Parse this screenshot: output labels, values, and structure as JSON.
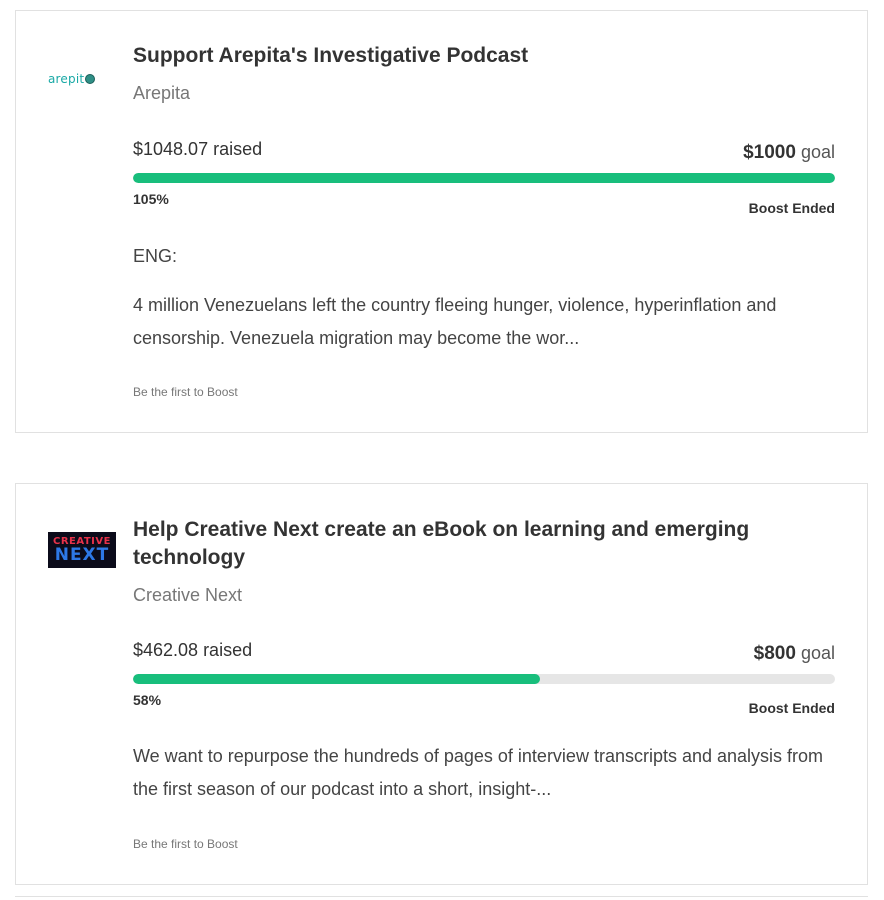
{
  "campaigns": [
    {
      "logo": {
        "type": "wordmark",
        "icon_name": "arepita-logo",
        "text": "arepit",
        "colors": {
          "text": "#19a9a6",
          "dot": "#2f8f86"
        }
      },
      "title": "Support Arepita's Investigative Podcast",
      "organization": "Arepita",
      "raised": "$1048.07 raised",
      "goal_amount": "$1000",
      "goal_suffix": "goal",
      "percent_label": "105%",
      "progress_fraction": 1.0,
      "status": "Boost Ended",
      "description_lead": "ENG:",
      "description": "4 million Venezuelans left the country fleeing hunger, violence, hyperinflation and censorship. Venezuela migration may become the wor...",
      "boost_cta": "Be the first to Boost"
    },
    {
      "logo": {
        "type": "image",
        "icon_name": "creative-next-logo",
        "line1": "CREATIVE",
        "line2": "NEXT",
        "colors": {
          "bg": "#0b0b1a",
          "line1": "#e8324a",
          "line2": "#2d78e6"
        }
      },
      "title": "Help Creative Next create an eBook on learning and emerging technology",
      "organization": "Creative Next",
      "raised": "$462.08 raised",
      "goal_amount": "$800",
      "goal_suffix": "goal",
      "percent_label": "58%",
      "progress_fraction": 0.58,
      "status": "Boost Ended",
      "description": "We want to repurpose the hundreds of pages of interview transcripts and analysis from the first season of our podcast into a short, insight-...",
      "boost_cta": "Be the first to Boost"
    }
  ],
  "colors": {
    "progress_fill": "#18be7c",
    "progress_track": "#e6e6e6",
    "card_border": "#e1e1e1"
  }
}
